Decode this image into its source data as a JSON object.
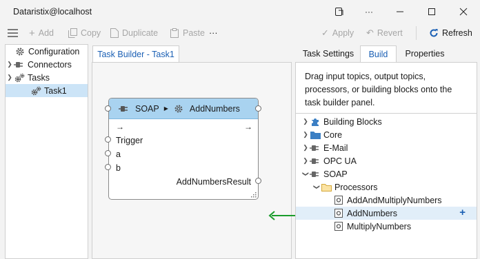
{
  "window": {
    "title": "Dataristix@localhost"
  },
  "toolbar": {
    "add": "Add",
    "copy": "Copy",
    "duplicate": "Duplicate",
    "paste": "Paste",
    "more": "···",
    "apply": "Apply",
    "revert": "Revert",
    "refresh": "Refresh"
  },
  "left_tree": {
    "items": [
      {
        "label": "Configuration",
        "icon": "gear-icon"
      },
      {
        "label": "Connectors",
        "icon": "plug-icon"
      },
      {
        "label": "Tasks",
        "icon": "gears-icon"
      },
      {
        "label": "Task1",
        "icon": "gears-icon",
        "selected": true
      }
    ]
  },
  "builder": {
    "tab_label": "Task Builder - Task1",
    "node": {
      "connector": "SOAP",
      "method": "AddNumbers",
      "in_arrow": "→",
      "out_arrow": "→",
      "inputs": [
        "Trigger",
        "a",
        "b"
      ],
      "output": "AddNumbersResult"
    }
  },
  "right_panel": {
    "tabs": [
      "Task Settings",
      "Build",
      "Properties"
    ],
    "active_tab": "Build",
    "help_text": "Drag input topics, output topics, processors, or building blocks onto the task builder panel.",
    "tree": [
      {
        "label": "Building Blocks",
        "icon": "puzzle-icon"
      },
      {
        "label": "Core",
        "icon": "folder-blue-icon"
      },
      {
        "label": "E-Mail",
        "icon": "plug-icon"
      },
      {
        "label": "OPC UA",
        "icon": "plug-icon"
      },
      {
        "label": "SOAP",
        "icon": "plug-icon"
      },
      {
        "label": "Processors",
        "icon": "folder-icon"
      },
      {
        "label": "AddAndMultiplyNumbers",
        "icon": "processor-icon"
      },
      {
        "label": "AddNumbers",
        "icon": "processor-icon",
        "selected": true
      },
      {
        "label": "MultiplyNumbers",
        "icon": "processor-icon"
      }
    ]
  },
  "colors": {
    "accent": "#1a5fb4",
    "selected": "#cce4f7",
    "node_header": "#a9d3f0",
    "arrow": "#1a9c2b"
  }
}
